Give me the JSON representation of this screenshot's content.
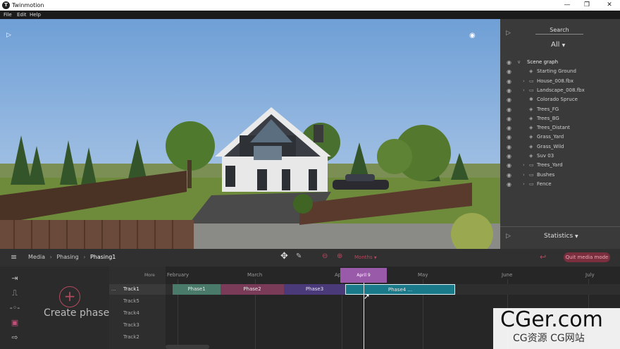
{
  "app": {
    "title": "Twinmotion",
    "logo_letter": "T"
  },
  "window_controls": {
    "minimize": "—",
    "maximize": "❐",
    "close": "✕"
  },
  "menu": [
    "File",
    "Edit",
    "Help"
  ],
  "viewport": {
    "play_glyph": "▷",
    "eye_glyph": "◉"
  },
  "right_panel": {
    "search_label": "Search",
    "filter_value": "All",
    "collapse_glyph": "▷",
    "tree": [
      {
        "label": "Scene graph",
        "arrow": "∨",
        "icon": ""
      },
      {
        "label": "Starting Ground",
        "arrow": "",
        "icon": "◈"
      },
      {
        "label": "House_008.fbx",
        "arrow": "›",
        "icon": "▭"
      },
      {
        "label": "Landscape_008.fbx",
        "arrow": "›",
        "icon": "▭"
      },
      {
        "label": "Colorado Spruce",
        "arrow": "",
        "icon": "✱"
      },
      {
        "label": "Trees_FG",
        "arrow": "",
        "icon": "◈"
      },
      {
        "label": "Trees_BG",
        "arrow": "",
        "icon": "◈"
      },
      {
        "label": "Trees_Distant",
        "arrow": "",
        "icon": "◈"
      },
      {
        "label": "Grass_Yard",
        "arrow": "",
        "icon": "◈"
      },
      {
        "label": "Grass_Wild",
        "arrow": "",
        "icon": "◈"
      },
      {
        "label": "Suv 03",
        "arrow": "",
        "icon": "◈"
      },
      {
        "label": "Trees_Yard",
        "arrow": "›",
        "icon": "▭"
      },
      {
        "label": "Bushes",
        "arrow": "›",
        "icon": "▭"
      },
      {
        "label": "Fence",
        "arrow": "›",
        "icon": "▭"
      }
    ],
    "statistics_label": "Statistics"
  },
  "bottom_bar": {
    "breadcrumb": [
      "Media",
      "Phasing",
      "Phasing1"
    ],
    "zoom_unit": "Months",
    "quit_label": "Quit media mode"
  },
  "timeline": {
    "create_label": "Create phase",
    "more_label": "More",
    "row_menu": "...",
    "tracks": [
      "Track1",
      "Track5",
      "Track4",
      "Track3",
      "Track2"
    ],
    "months": [
      "February",
      "March",
      "April",
      "May",
      "June",
      "July"
    ],
    "cursor_label": "April 9",
    "phases": [
      {
        "label": "Phase1",
        "color": "#4a7a6a"
      },
      {
        "label": "Phase2",
        "color": "#7a3b58"
      },
      {
        "label": "Phase3",
        "color": "#4a3a7a"
      },
      {
        "label": "Phase4 ...",
        "color": "#1a7a8a"
      }
    ]
  },
  "watermark": {
    "big": "CGer.com",
    "small": "CG资源 CG网站"
  }
}
